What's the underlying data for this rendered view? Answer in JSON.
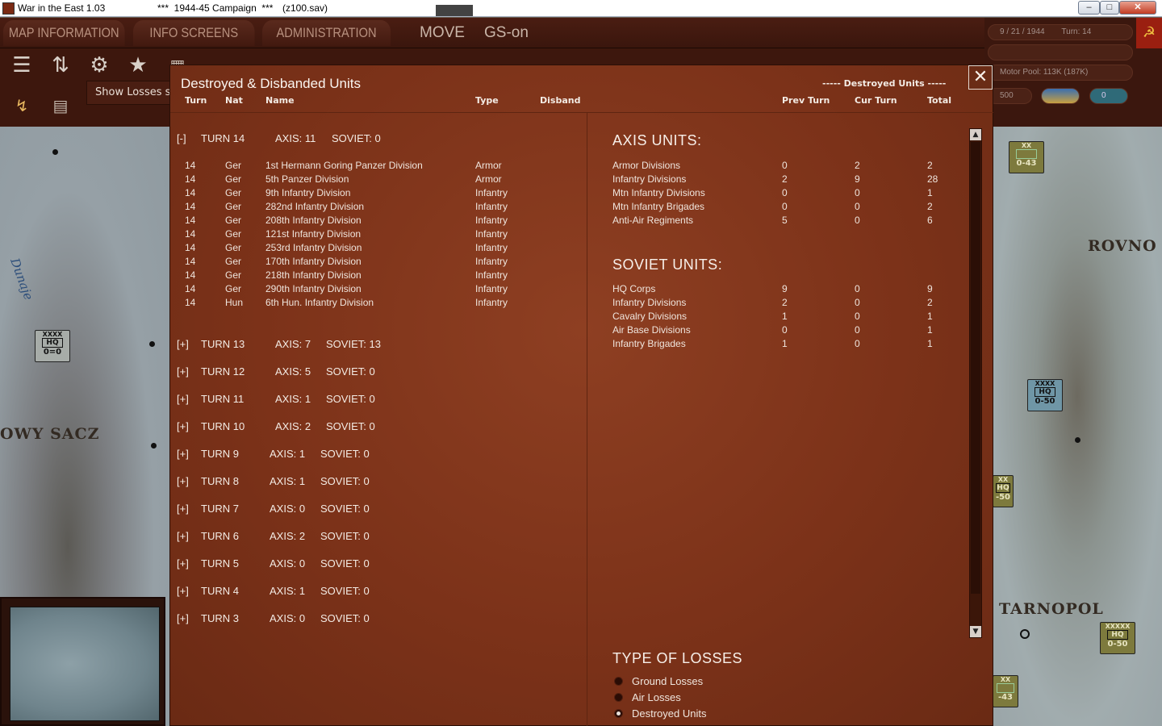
{
  "window": {
    "title": "War in the East 1.03",
    "campaign": "***  1944-45 Campaign  ***",
    "save_file": "(z100.sav)"
  },
  "menu": {
    "tabs": [
      "MAP INFORMATION",
      "INFO SCREENS",
      "ADMINISTRATION"
    ],
    "mode": "MOVE",
    "gs": "GS-on"
  },
  "tooltip": "Show Losses s",
  "info_panel": {
    "date": "9 / 21 / 1944",
    "turn": "Turn: 14",
    "motor_pool": "Motor Pool: 113K (187K)",
    "value_a": "500",
    "value_b": "0"
  },
  "map": {
    "cities": [
      "ROVNO",
      "OWY SACZ",
      "TARNOPOL"
    ],
    "river": "Dunaje",
    "counters": [
      {
        "size": "XXXX",
        "type": "HQ",
        "strength": "0=0"
      },
      {
        "size": "XX",
        "type": "",
        "strength": "0-43"
      },
      {
        "size": "XXXX",
        "type": "HQ",
        "strength": "0-50"
      },
      {
        "size": "XX",
        "type": "HQ",
        "strength": "-50"
      },
      {
        "size": "XXXXX",
        "type": "HQ",
        "strength": "0-50"
      },
      {
        "size": "XX",
        "type": "",
        "strength": "-43"
      }
    ]
  },
  "dialog": {
    "title": "Destroyed & Disbanded Units",
    "close": "✕",
    "mode_label": "----- Destroyed Units -----",
    "left_headers": {
      "turn": "Turn",
      "nat": "Nat",
      "name": "Name",
      "type": "Type",
      "disband": "Disband"
    },
    "right_headers": {
      "prev": "Prev Turn",
      "cur": "Cur Turn",
      "total": "Total"
    },
    "expanded_turn": {
      "toggle": "[-]",
      "label": "TURN 14",
      "axis": "AXIS: 11",
      "soviet": "SOVIET: 0"
    },
    "units": [
      {
        "turn": "14",
        "nat": "Ger",
        "name": "1st Hermann Goring Panzer Division",
        "type": "Armor"
      },
      {
        "turn": "14",
        "nat": "Ger",
        "name": "5th Panzer Division",
        "type": "Armor"
      },
      {
        "turn": "14",
        "nat": "Ger",
        "name": "9th Infantry Division",
        "type": "Infantry"
      },
      {
        "turn": "14",
        "nat": "Ger",
        "name": "282nd Infantry Division",
        "type": "Infantry"
      },
      {
        "turn": "14",
        "nat": "Ger",
        "name": "208th Infantry Division",
        "type": "Infantry"
      },
      {
        "turn": "14",
        "nat": "Ger",
        "name": "121st Infantry Division",
        "type": "Infantry"
      },
      {
        "turn": "14",
        "nat": "Ger",
        "name": "253rd Infantry Division",
        "type": "Infantry"
      },
      {
        "turn": "14",
        "nat": "Ger",
        "name": "170th Infantry Division",
        "type": "Infantry"
      },
      {
        "turn": "14",
        "nat": "Ger",
        "name": "218th Infantry Division",
        "type": "Infantry"
      },
      {
        "turn": "14",
        "nat": "Ger",
        "name": "290th Infantry Division",
        "type": "Infantry"
      },
      {
        "turn": "14",
        "nat": "Hun",
        "name": "6th Hun. Infantry Division",
        "type": "Infantry"
      }
    ],
    "collapsed_turns": [
      {
        "toggle": "[+]",
        "label": "TURN 13",
        "axis": "AXIS: 7",
        "soviet": "SOVIET: 13"
      },
      {
        "toggle": "[+]",
        "label": "TURN 12",
        "axis": "AXIS: 5",
        "soviet": "SOVIET: 0"
      },
      {
        "toggle": "[+]",
        "label": "TURN 11",
        "axis": "AXIS: 1",
        "soviet": "SOVIET: 0"
      },
      {
        "toggle": "[+]",
        "label": "TURN 10",
        "axis": "AXIS: 2",
        "soviet": "SOVIET: 0"
      },
      {
        "toggle": "[+]",
        "label": "TURN 9",
        "axis": "AXIS: 1",
        "soviet": "SOVIET: 0"
      },
      {
        "toggle": "[+]",
        "label": "TURN 8",
        "axis": "AXIS: 1",
        "soviet": "SOVIET: 0"
      },
      {
        "toggle": "[+]",
        "label": "TURN 7",
        "axis": "AXIS: 0",
        "soviet": "SOVIET: 0"
      },
      {
        "toggle": "[+]",
        "label": "TURN 6",
        "axis": "AXIS: 2",
        "soviet": "SOVIET: 0"
      },
      {
        "toggle": "[+]",
        "label": "TURN 5",
        "axis": "AXIS: 0",
        "soviet": "SOVIET: 0"
      },
      {
        "toggle": "[+]",
        "label": "TURN 4",
        "axis": "AXIS: 1",
        "soviet": "SOVIET: 0"
      },
      {
        "toggle": "[+]",
        "label": "TURN 3",
        "axis": "AXIS: 0",
        "soviet": "SOVIET: 0"
      }
    ],
    "axis_section": {
      "title": "AXIS UNITS:",
      "rows": [
        {
          "name": "Armor Divisions",
          "prev": "0",
          "cur": "2",
          "total": "2"
        },
        {
          "name": "Infantry Divisions",
          "prev": "2",
          "cur": "9",
          "total": "28"
        },
        {
          "name": "Mtn Infantry Divisions",
          "prev": "0",
          "cur": "0",
          "total": "1"
        },
        {
          "name": "Mtn Infantry Brigades",
          "prev": "0",
          "cur": "0",
          "total": "2"
        },
        {
          "name": "Anti-Air Regiments",
          "prev": "5",
          "cur": "0",
          "total": "6"
        }
      ]
    },
    "soviet_section": {
      "title": "SOVIET UNITS:",
      "rows": [
        {
          "name": "HQ Corps",
          "prev": "9",
          "cur": "0",
          "total": "9"
        },
        {
          "name": "Infantry Divisions",
          "prev": "2",
          "cur": "0",
          "total": "2"
        },
        {
          "name": "Cavalry Divisions",
          "prev": "1",
          "cur": "0",
          "total": "1"
        },
        {
          "name": "Air Base Divisions",
          "prev": "0",
          "cur": "0",
          "total": "1"
        },
        {
          "name": "Infantry Brigades",
          "prev": "1",
          "cur": "0",
          "total": "1"
        }
      ]
    },
    "loss_types": {
      "title": "TYPE OF LOSSES",
      "options": [
        "Ground Losses",
        "Air Losses",
        "Destroyed Units"
      ],
      "selected": "Destroyed Units"
    }
  }
}
